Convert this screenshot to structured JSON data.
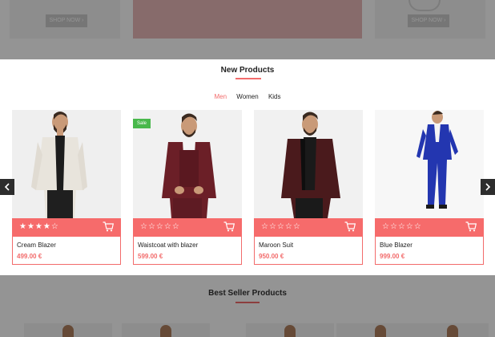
{
  "top_banner": {
    "shop_now_left": "SHOP NOW ›",
    "shop_now_right": "SHOP NOW ›"
  },
  "section": {
    "title": "New Products",
    "tabs": [
      {
        "label": "Men",
        "active": true
      },
      {
        "label": "Women",
        "active": false
      },
      {
        "label": "Kids",
        "active": false
      }
    ]
  },
  "products": [
    {
      "name": "Cream Blazer",
      "price": "499.00 €",
      "rating": 4,
      "badge": "",
      "stars_text": "★★★★☆",
      "suit_color": "#e8e4dc",
      "shirt_color": "#1c1c1c"
    },
    {
      "name": "Waistcoat with blazer",
      "price": "599.00 €",
      "rating": 0,
      "badge": "Sale",
      "stars_text": "☆☆☆☆☆",
      "suit_color": "#6b1f27",
      "shirt_color": "#f4f4f4"
    },
    {
      "name": "Maroon Suit",
      "price": "950.00 €",
      "rating": 0,
      "badge": "",
      "stars_text": "☆☆☆☆☆",
      "suit_color": "#4a1a1c",
      "shirt_color": "#1a1a1a"
    },
    {
      "name": "Blue Blazer",
      "price": "999.00 €",
      "rating": 0,
      "badge": "",
      "stars_text": "☆☆☆☆☆",
      "suit_color": "#2336b0",
      "shirt_color": "#f4f4f4"
    }
  ],
  "bottom": {
    "title": "Best Seller Products"
  },
  "colors": {
    "accent": "#f26b6b",
    "sale": "#49b84c",
    "arrow": "#2d2d2d"
  },
  "icons": {
    "prev": "chevron-left-icon",
    "next": "chevron-right-icon",
    "cart": "cart-icon",
    "star": "star-icon"
  }
}
